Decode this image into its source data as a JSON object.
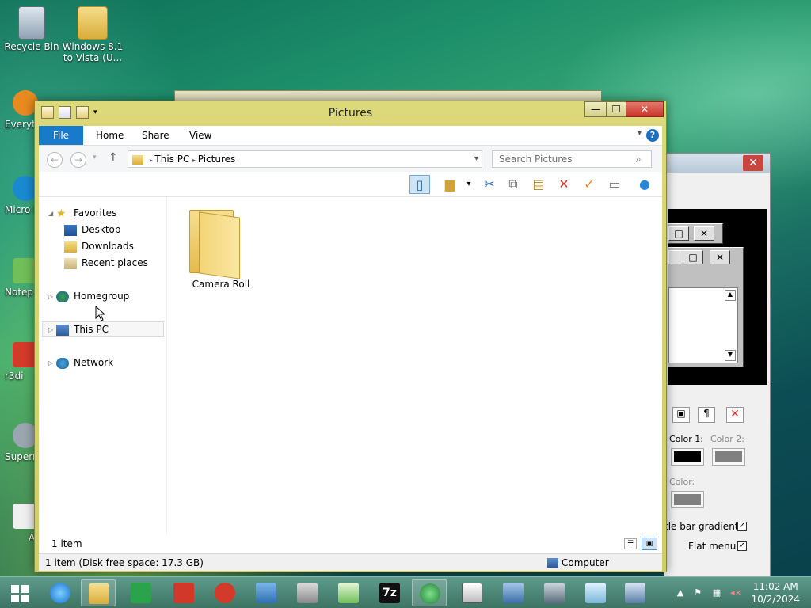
{
  "desktop": {
    "icons": [
      {
        "label": "Recycle Bin",
        "icon": "recycle-bin-icon"
      },
      {
        "label": "Windows 8.1 to Vista (U...",
        "icon": "folder-icon"
      }
    ],
    "partial_labels": [
      "Everyt",
      "Micro Edg",
      "Notep",
      "r3di",
      "Superr",
      "A"
    ]
  },
  "background_window": {
    "color1_label": "Color 1:",
    "color2_label": "Color 2:",
    "color3_label": "Color:",
    "title_gradients_label": "tle bar gradients",
    "flat_menus_label": "Flat menus",
    "close_glyph": "✕",
    "colors": {
      "color1": "#000000",
      "color2": "#808080",
      "color3": "#808080"
    }
  },
  "explorer": {
    "title": "Pictures",
    "caption": {
      "minimize": "—",
      "maximize": "❐",
      "close": "✕"
    },
    "ribbon_tabs": [
      "File",
      "Home",
      "Share",
      "View"
    ],
    "help": "?",
    "address": {
      "segments": [
        "This PC",
        "Pictures"
      ]
    },
    "search": {
      "placeholder": "Search Pictures"
    },
    "nav": {
      "favorites": "Favorites",
      "favorites_items": [
        "Desktop",
        "Downloads",
        "Recent places"
      ],
      "homegroup": "Homegroup",
      "this_pc": "This PC",
      "network": "Network"
    },
    "items": [
      {
        "name": "Camera Roll",
        "type": "folder"
      }
    ],
    "status": {
      "count": "1 item",
      "details": "1 item (Disk free space: 17.3 GB)",
      "location": "Computer"
    }
  },
  "taskbar": {
    "time": "11:02 AM",
    "date": "10/2/2024",
    "apps": [
      "start-button",
      "internet-explorer-icon",
      "file-explorer-icon",
      "store-icon",
      "app-red-icon",
      "app-d-icon",
      "app-settings-icon",
      "app-printer-icon",
      "app-notepad-icon",
      "7zip-icon",
      "app-globe-icon",
      "app-window-icon",
      "app-network-icon",
      "app-monitor-icon",
      "app-glass-icon",
      "app-keyboard-icon"
    ],
    "seven_zip": "7z"
  },
  "colors": {
    "accent": "#1979ca",
    "titlebar": "#d6d376"
  }
}
